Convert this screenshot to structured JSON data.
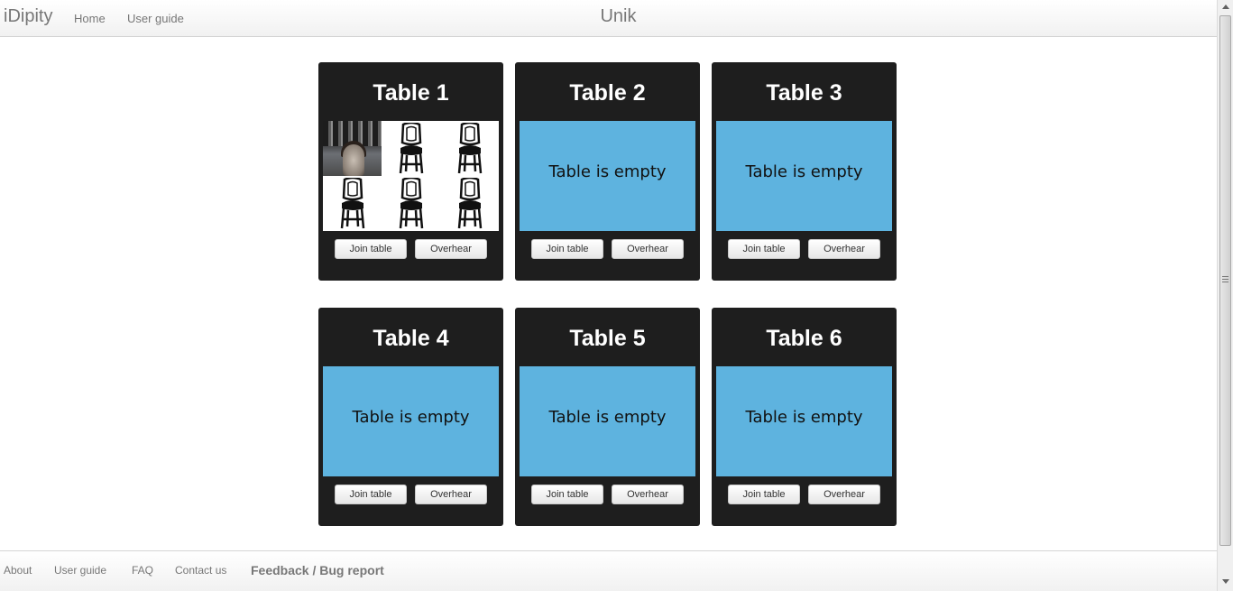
{
  "header": {
    "brand": "iDipity",
    "nav": {
      "home": "Home",
      "user_guide": "User guide"
    },
    "page_title": "Unik"
  },
  "tables": [
    {
      "name": "Table 1",
      "status": "",
      "occupied": true,
      "join_label": "Join table",
      "overhear_label": "Overhear"
    },
    {
      "name": "Table 2",
      "status": "Table is empty",
      "occupied": false,
      "join_label": "Join table",
      "overhear_label": "Overhear"
    },
    {
      "name": "Table 3",
      "status": "Table is empty",
      "occupied": false,
      "join_label": "Join table",
      "overhear_label": "Overhear"
    },
    {
      "name": "Table 4",
      "status": "Table is empty",
      "occupied": false,
      "join_label": "Join table",
      "overhear_label": "Overhear"
    },
    {
      "name": "Table 5",
      "status": "Table is empty",
      "occupied": false,
      "join_label": "Join table",
      "overhear_label": "Overhear"
    },
    {
      "name": "Table 6",
      "status": "Table is empty",
      "occupied": false,
      "join_label": "Join table",
      "overhear_label": "Overhear"
    }
  ],
  "table_1_seats": {
    "occupied_seats": 1,
    "empty_seats": 5,
    "seat_icon": "chair-icon"
  },
  "footer": {
    "about": "About",
    "user_guide": "User guide",
    "faq": "FAQ",
    "contact": "Contact us",
    "feedback": "Feedback / Bug report"
  },
  "colors": {
    "card_background": "#1e1e1e",
    "empty_table": "#5eb3df",
    "nav_text": "#777777"
  }
}
